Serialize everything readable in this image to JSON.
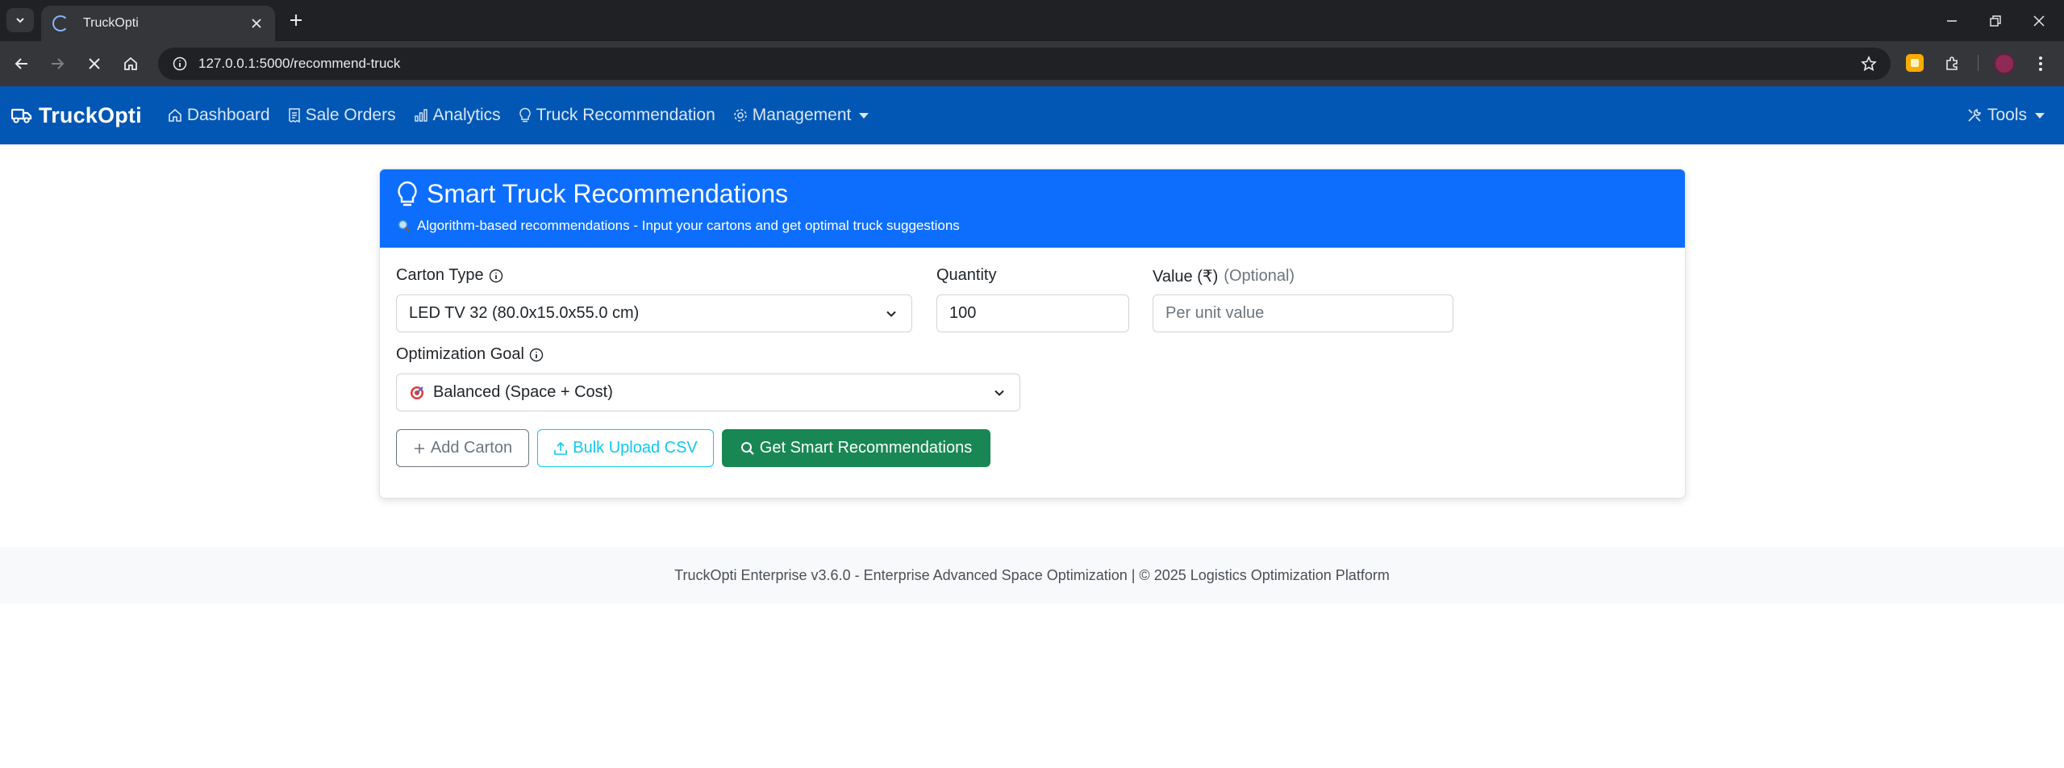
{
  "browser": {
    "tab_title": "TruckOpti",
    "url": "127.0.0.1:5000/recommend-truck"
  },
  "navbar": {
    "brand": "TruckOpti",
    "items": [
      {
        "label": "Dashboard",
        "icon": "house-icon"
      },
      {
        "label": "Sale Orders",
        "icon": "receipt-icon"
      },
      {
        "label": "Analytics",
        "icon": "bar-chart-icon"
      },
      {
        "label": "Truck Recommendation",
        "icon": "lightbulb-icon"
      },
      {
        "label": "Management",
        "icon": "gear-icon"
      }
    ],
    "tools_label": "Tools"
  },
  "card": {
    "title": "Smart Truck Recommendations",
    "subtitle": "Algorithm-based recommendations - Input your cartons and get optimal truck suggestions"
  },
  "form": {
    "carton_type_label": "Carton Type",
    "carton_type_value": "LED TV 32 (80.0x15.0x55.0 cm)",
    "quantity_label": "Quantity",
    "quantity_value": "100",
    "value_label": "Value (₹)",
    "value_label_optional": "(Optional)",
    "value_placeholder": "Per unit value",
    "optimization_goal_label": "Optimization Goal",
    "optimization_goal_value": "Balanced (Space + Cost)"
  },
  "buttons": {
    "add_carton": "Add Carton",
    "bulk_upload": "Bulk Upload CSV",
    "get_recommendations": "Get Smart Recommendations"
  },
  "footer": {
    "text": "TruckOpti Enterprise v3.6.0 - Enterprise Advanced Space Optimization | © 2025 Logistics Optimization Platform"
  },
  "colors": {
    "navbar": "#0257b5",
    "card_header": "#0d6efd",
    "primary_button": "#198754",
    "info_button": "#0dcaf0"
  }
}
